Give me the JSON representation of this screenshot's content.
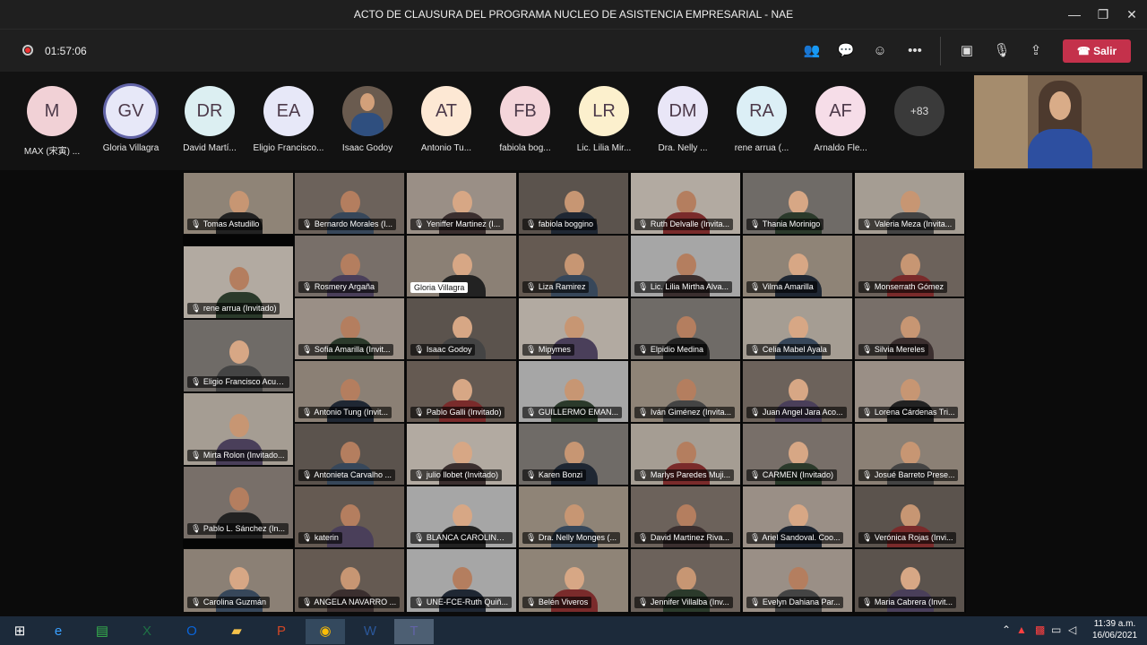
{
  "window": {
    "title": "ACTO DE CLAUSURA DEL PROGRAMA NUCLEO DE ASISTENCIA EMPRESARIAL - NAE",
    "controls": [
      "minimize-icon",
      "restore-icon",
      "close-icon"
    ]
  },
  "toolbar": {
    "record_icon": "record-icon",
    "timer": "01:57:06",
    "icons": [
      "participants-icon",
      "chat-icon",
      "reactions-icon",
      "more-options-icon",
      "camera-icon",
      "mute-mic-icon",
      "share-screen-icon"
    ],
    "leave_label": "Salir",
    "leave_color": "#c4314b"
  },
  "participants_strip": [
    {
      "initials": "M",
      "name": "MAX (宋寅) ...",
      "color": "#f1d1d6"
    },
    {
      "initials": "GV",
      "name": "Gloria Villagra",
      "color": "#e7e8f8",
      "active": true
    },
    {
      "initials": "DR",
      "name": "David Martí...",
      "color": "#dceff2"
    },
    {
      "initials": "EA",
      "name": "Eligio Francisco...",
      "color": "#e7e8f8"
    },
    {
      "initials": "",
      "name": "Isaac Godoy",
      "photo": true
    },
    {
      "initials": "AT",
      "name": "Antonio Tu...",
      "color": "#fde8d4"
    },
    {
      "initials": "FB",
      "name": "fabiola bog...",
      "color": "#f4d5da"
    },
    {
      "initials": "LR",
      "name": "Lic. Lilia Mir...",
      "color": "#fcf0cd"
    },
    {
      "initials": "DM",
      "name": "Dra. Nelly ...",
      "color": "#e9e6f7"
    },
    {
      "initials": "RA",
      "name": "rene arrua (...",
      "color": "#dceff6"
    },
    {
      "initials": "AF",
      "name": "Arnaldo Fle...",
      "color": "#f6dde8"
    }
  ],
  "more_count": "+83",
  "gallery": [
    [
      "Tomas Astudillo",
      "Bernardo Morales (I...",
      "Yeniffer Martinez (I...",
      "fabiola boggino",
      "Ruth Delvalle (Invita...",
      "Thania Morinigo",
      "Valeria Meza (Invita..."
    ],
    [
      "Rosmery Argaña",
      "Gloria Villagra",
      "Liza Ramirez",
      "Lic. Lilia Mirtha Alva...",
      "Vilma Amarilla",
      "Monserrath Gómez"
    ],
    [
      "rene arrua (Invitado)"
    ],
    [
      "Sofia Amarilla (Invit...",
      "Isaac Godoy",
      "Mipymes",
      "Elpidio Medina",
      "Celia Mabel Ayala",
      "Silvia Mereles"
    ],
    [
      "Eligio Francisco Acuña..."
    ],
    [
      "Antonio Tung (Invit...",
      "Pablo Galli (Invitado)",
      "GUILLERMO EMAN...",
      "Iván Giménez (Invita...",
      "Juan Angel Jara Aco...",
      "Lorena Cárdenas Tri..."
    ],
    [
      "Mirta Rolon (Invitado..."
    ],
    [
      "Antonieta Carvalho ...",
      "julio llobet (Invitado)",
      "Karen Bonzi",
      "Marlys Paredes Muji...",
      "CARMEN (Invitado)",
      "Josué Barreto Prese..."
    ],
    [
      "Pablo L. Sánchez (In..."
    ],
    [
      "katerin",
      "BLANCA CAROLINA ...",
      "Dra. Nelly Monges (...",
      "David Martinez Riva...",
      "Ariel Sandoval. Coo...",
      "Verónica Rojas (Invi..."
    ],
    [
      "Carolina Guzmán",
      "ANGELA NAVARRO ...",
      "UNE-FCE-Ruth Quiñ...",
      "Belén Viveros",
      "Jennifer Villalba (Inv...",
      "Evelyn Dahiana Par...",
      "Maria Cabrera (Invit..."
    ]
  ],
  "taskbar": {
    "apps": [
      "windows-start-icon",
      "internet-explorer-icon",
      "store-icon",
      "excel-icon",
      "outlook-icon",
      "file-explorer-icon",
      "powerpoint-icon",
      "chrome-icon",
      "word-icon",
      "teams-icon"
    ],
    "time": "11:39 a.m.",
    "date": "16/06/2021"
  }
}
